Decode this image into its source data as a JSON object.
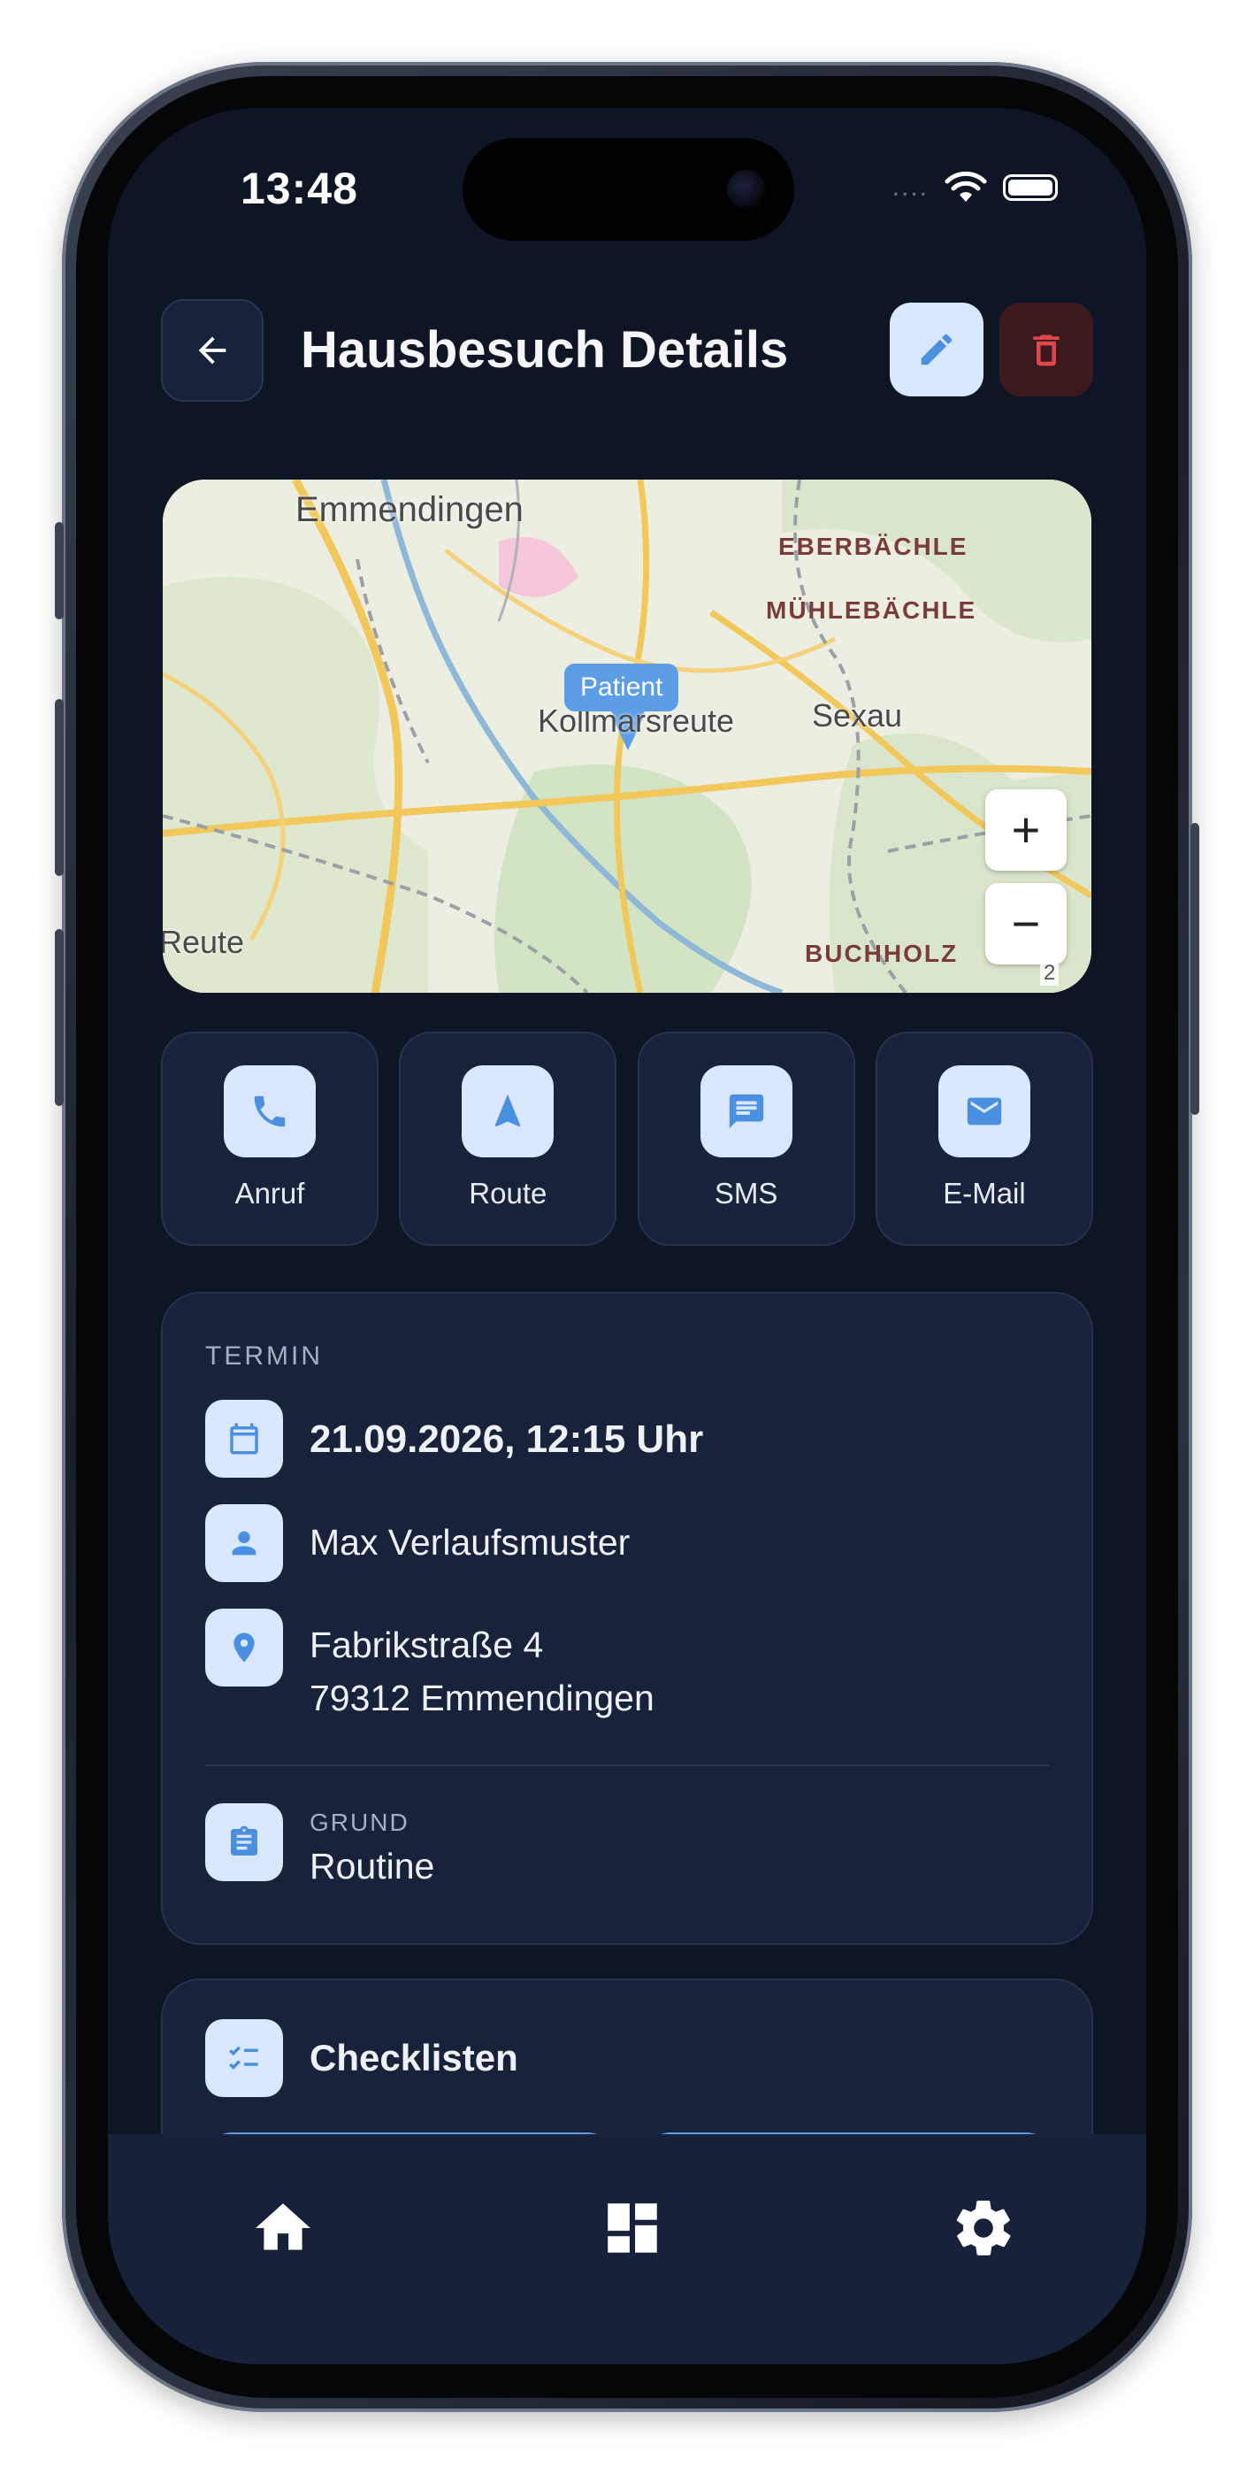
{
  "status_bar": {
    "time": "13:48",
    "signal_dots": "....",
    "wifi_icon": "wifi-icon",
    "battery_icon": "battery-icon"
  },
  "header": {
    "title": "Hausbesuch Details",
    "back_icon": "arrow-left-icon",
    "edit_icon": "pencil-icon",
    "delete_icon": "trash-icon"
  },
  "map": {
    "marker_label": "Patient",
    "places": [
      "Emmendingen",
      "EBERBÄCHLE",
      "MÜHLEBÄCHLE",
      "Kollmarsreute",
      "Sexau",
      "Reute",
      "BUCHHOLZ"
    ],
    "zoom_in": "+",
    "zoom_out": "−",
    "attribution": "2"
  },
  "actions": [
    {
      "label": "Anruf",
      "icon": "phone-icon"
    },
    {
      "label": "Route",
      "icon": "navigation-arrow-icon"
    },
    {
      "label": "SMS",
      "icon": "message-icon"
    },
    {
      "label": "E-Mail",
      "icon": "mail-icon"
    }
  ],
  "termin": {
    "section_label": "TERMIN",
    "date": "21.09.2026, 12:15 Uhr",
    "patient": "Max Verlaufsmuster",
    "address_line1": "Fabrikstraße 4",
    "address_line2": "79312 Emmendingen",
    "reason_label": "GRUND",
    "reason": "Routine"
  },
  "checklists": {
    "title": "Checklisten",
    "icon": "checklist-icon"
  },
  "bottom_nav": [
    {
      "icon": "home-icon"
    },
    {
      "icon": "dashboard-icon"
    },
    {
      "icon": "settings-gear-icon"
    }
  ],
  "colors": {
    "background": "#0e1626",
    "card": "#18223a",
    "accent": "#5b9ee6",
    "icon_bg": "#d9e8ff",
    "danger": "#e0474c"
  }
}
